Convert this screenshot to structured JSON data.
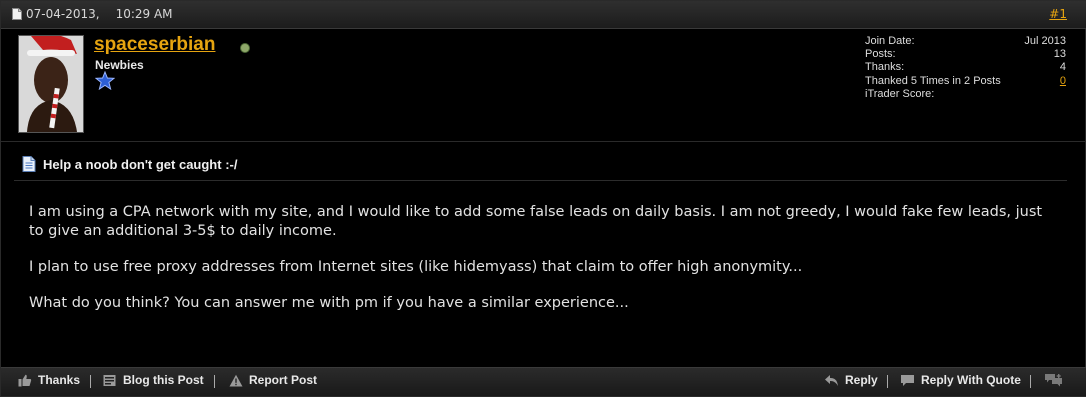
{
  "post": {
    "date": "07-04-2013,",
    "time": "10:29 AM",
    "number": "#1"
  },
  "user": {
    "username": "spaceserbian",
    "title": "Newbies",
    "online": true,
    "stats": [
      {
        "label": "Join Date:",
        "value": "Jul 2013"
      },
      {
        "label": "Posts:",
        "value": "13"
      },
      {
        "label": "Thanks:",
        "value": "4"
      },
      {
        "label": "Thanked 5 Times in 2 Posts",
        "value": "0"
      },
      {
        "label": "iTrader Score:",
        "value": ""
      }
    ]
  },
  "content": {
    "title": "Help a noob don't get caught :-/",
    "paragraphs": [
      "I am using a CPA network with my site, and I would like to add some false leads on daily basis. I am not greedy, I would fake few leads, just to give an additional 3-5$ to daily income.",
      "I plan to use free proxy addresses from Internet sites (like hidemyass) that claim to offer high anonymity...",
      "What do you think? You can answer me with pm if you have a similar experience..."
    ]
  },
  "footer": {
    "thanks_label": "Thanks",
    "blog_label": "Blog this Post",
    "report_label": "Report Post",
    "reply_label": "Reply",
    "quote_label": "Reply With Quote"
  },
  "colors": {
    "link": "#e6a410",
    "background": "#000000",
    "online": "#8fa86a"
  }
}
